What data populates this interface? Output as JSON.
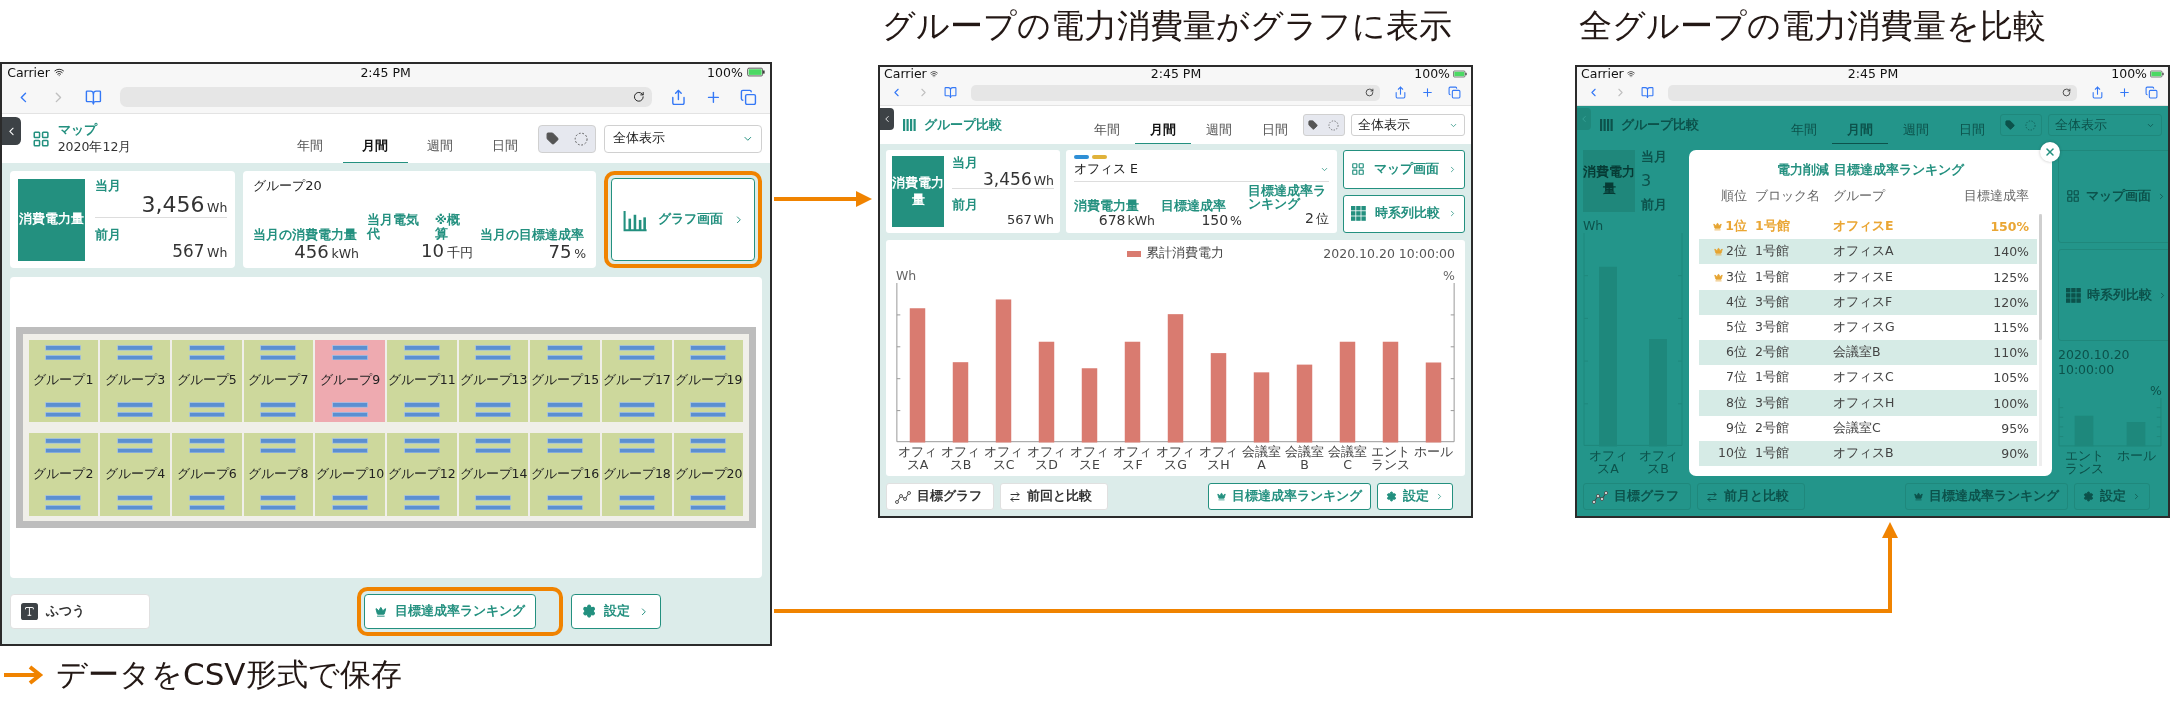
{
  "left_screen": {
    "status_bar": {
      "carrier": "Carrier",
      "time": "2:45 PM",
      "battery": "100%"
    },
    "header": {
      "title": "マップ",
      "subtitle": "2020年12月",
      "kind": "grid"
    },
    "tabs": [
      {
        "label": "年間",
        "selected": false
      },
      {
        "label": "月間",
        "selected": true
      },
      {
        "label": "週間",
        "selected": false
      },
      {
        "label": "日間",
        "selected": false
      }
    ],
    "view_select": "全体表示",
    "power_card": {
      "label": "消費電力量",
      "current_label": "当月",
      "current_value": "3,456",
      "current_unit": "Wh",
      "previous_label": "前月",
      "previous_value": "567",
      "previous_unit": "Wh"
    },
    "group_card": {
      "title": "グループ20",
      "stats": [
        {
          "label": "当月の消費電力量",
          "value": "456",
          "unit": "kWh"
        },
        {
          "label": "当月電気代",
          "note": "※概算",
          "value": "10",
          "unit": "千円"
        },
        {
          "label": "当月の目標達成率",
          "value": "75",
          "unit": "%"
        }
      ]
    },
    "nav_buttons": [
      {
        "label": "グラフ画面",
        "kind": "bars",
        "highlighted": true
      }
    ],
    "map": {
      "groups": [
        {
          "label": "グループ1",
          "selected": false
        },
        {
          "label": "グループ3",
          "selected": false
        },
        {
          "label": "グループ5",
          "selected": false
        },
        {
          "label": "グループ7",
          "selected": false
        },
        {
          "label": "グループ9",
          "selected": true
        },
        {
          "label": "グループ11",
          "selected": false
        },
        {
          "label": "グループ13",
          "selected": false
        },
        {
          "label": "グループ15",
          "selected": false
        },
        {
          "label": "グループ17",
          "selected": false
        },
        {
          "label": "グループ19",
          "selected": false
        },
        {
          "label": "グループ2",
          "selected": false
        },
        {
          "label": "グループ4",
          "selected": false
        },
        {
          "label": "グループ6",
          "selected": false
        },
        {
          "label": "グループ8",
          "selected": false
        },
        {
          "label": "グループ10",
          "selected": false
        },
        {
          "label": "グループ12",
          "selected": false
        },
        {
          "label": "グループ14",
          "selected": false
        },
        {
          "label": "グループ16",
          "selected": false
        },
        {
          "label": "グループ18",
          "selected": false
        },
        {
          "label": "グループ20",
          "selected": false
        }
      ]
    },
    "footer_left": [
      {
        "label": "ふつう",
        "kind": "font-size"
      }
    ],
    "footer_right": [
      {
        "label": "目標達成率ランキング",
        "kind": "crown",
        "highlighted": true
      },
      {
        "label": "設定",
        "kind": "gear",
        "highlighted": false
      }
    ]
  },
  "middle_heading": "グループの電力消費量がグラフに表示",
  "middle_screen": {
    "status_bar": {
      "carrier": "Carrier",
      "time": "2:45 PM",
      "battery": "100%"
    },
    "header": {
      "title": "グループ比較",
      "kind": "columns"
    },
    "tabs": [
      {
        "label": "年間",
        "selected": false
      },
      {
        "label": "月間",
        "selected": true
      },
      {
        "label": "週間",
        "selected": false
      },
      {
        "label": "日間",
        "selected": false
      }
    ],
    "view_select": "全体表示",
    "power_card": {
      "label": "消費電力量",
      "current_label": "当月",
      "current_value": "3,456",
      "current_unit": "Wh",
      "previous_label": "前月",
      "previous_value": "567",
      "previous_unit": "Wh"
    },
    "group_card": {
      "color_tags": [
        {
          "color": "#2f8fd6"
        },
        {
          "color": "#e0b23a"
        }
      ],
      "title": "オフィス E",
      "dropdown": true,
      "stats": [
        {
          "label": "消費電力量",
          "value": "678",
          "unit": "kWh"
        },
        {
          "label": "目標達成率",
          "value": "150",
          "unit": "%"
        },
        {
          "label": "目標達成率ランキング",
          "value": "2",
          "unit": "位"
        }
      ]
    },
    "nav_buttons": [
      {
        "label": "マップ画面",
        "kind": "grid",
        "highlighted": false
      },
      {
        "label": "時系列比較",
        "kind": "calendar",
        "highlighted": false
      }
    ],
    "chart": {
      "legend": "累計消費電力",
      "timestamp": "2020.10.20 10:00:00",
      "y_label_left": "Wh",
      "y_label_right": "%",
      "categories": [
        "オフィスA",
        "オフィスB",
        "オフィスC",
        "オフィスD",
        "オフィスE",
        "オフィスF",
        "オフィスG",
        "オフィスH",
        "会議室A",
        "会議室B",
        "会議室C",
        "エントランス",
        "ホール"
      ]
    },
    "footer_left": [
      {
        "label": "目標グラフ",
        "kind": "line"
      },
      {
        "label": "前回と比較",
        "kind": "compare"
      }
    ],
    "footer_right": [
      {
        "label": "目標達成率ランキング",
        "kind": "crown",
        "highlighted": false
      },
      {
        "label": "設定",
        "kind": "gear",
        "highlighted": false
      }
    ]
  },
  "right_heading": "全グループの電力消費量を比較",
  "right_screen": {
    "status_bar": {
      "carrier": "Carrier",
      "time": "2:45 PM",
      "battery": "100%"
    },
    "backdrop": {
      "header": {
        "title": "グループ比較",
        "kind": "columns"
      },
      "tabs": [
        {
          "label": "年間",
          "selected": false
        },
        {
          "label": "月間",
          "selected": true
        },
        {
          "label": "週間",
          "selected": false
        },
        {
          "label": "日間",
          "selected": false
        }
      ],
      "view_select": "全体表示",
      "power_label": "消費電力量",
      "current_label": "当月",
      "current_value": "3",
      "previous_label": "前月",
      "y_label_left": "Wh",
      "y_label_right": "%",
      "categories_left": [
        "オフィスA",
        "オフィスB"
      ],
      "categories_right": [
        "エントランス",
        "ホール"
      ],
      "nav_buttons": [
        {
          "label": "マップ画面",
          "kind": "grid",
          "highlighted": false
        },
        {
          "label": "時系列比較",
          "kind": "calendar",
          "highlighted": false
        }
      ],
      "timestamp": "2020.10.20 10:00:00",
      "footer_left": [
        {
          "label": "目標グラフ",
          "kind": "line"
        },
        {
          "label": "前月と比較",
          "kind": "compare"
        }
      ],
      "footer_right": [
        {
          "label": "目標達成率ランキング",
          "kind": "crown",
          "highlighted": false
        },
        {
          "label": "設定",
          "kind": "gear",
          "highlighted": false
        }
      ]
    },
    "modal": {
      "title": "電力削減 目標達成率ランキング",
      "columns": [
        "順位",
        "ブロック名",
        "グループ",
        "目標達成率"
      ],
      "rows": [
        {
          "rank": "1位",
          "block": "1号館",
          "group": "オフィスE",
          "value": "150%",
          "crown": true,
          "top": true
        },
        {
          "rank": "2位",
          "block": "1号館",
          "group": "オフィスA",
          "value": "140%",
          "crown": true,
          "top": false
        },
        {
          "rank": "3位",
          "block": "1号館",
          "group": "オフィスE",
          "value": "125%",
          "crown": true,
          "top": false
        },
        {
          "rank": "4位",
          "block": "3号館",
          "group": "オフィスF",
          "value": "120%",
          "crown": false,
          "top": false
        },
        {
          "rank": "5位",
          "block": "3号館",
          "group": "オフィスG",
          "value": "115%",
          "crown": false,
          "top": false
        },
        {
          "rank": "6位",
          "block": "2号館",
          "group": "会議室B",
          "value": "110%",
          "crown": false,
          "top": false
        },
        {
          "rank": "7位",
          "block": "1号館",
          "group": "オフィスC",
          "value": "105%",
          "crown": false,
          "top": false
        },
        {
          "rank": "8位",
          "block": "3号館",
          "group": "オフィスH",
          "value": "100%",
          "crown": false,
          "top": false
        },
        {
          "rank": "9位",
          "block": "2号館",
          "group": "会議室C",
          "value": "95%",
          "crown": false,
          "top": false
        },
        {
          "rank": "10位",
          "block": "1号館",
          "group": "オフィスB",
          "value": "90%",
          "crown": false,
          "top": false
        }
      ]
    }
  },
  "footnote": "データをCSV形式で保存"
}
